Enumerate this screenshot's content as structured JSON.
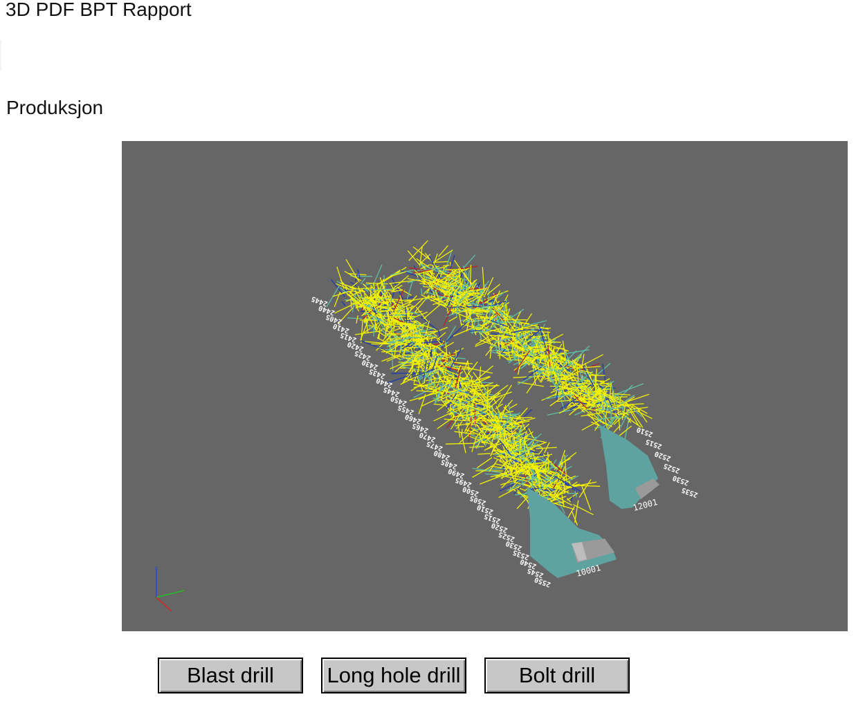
{
  "document": {
    "title": "3D PDF BPT Rapport",
    "section_heading": "Produksjon"
  },
  "viewer": {
    "background_color": "#666666",
    "drill_hole_color": "#f2f200",
    "tunnel_color": "#5fa3a0",
    "axis_triad": {
      "x_color": "#e02020",
      "y_color": "#20c020",
      "z_color": "#2040ff"
    },
    "left_tunnel_chainage_labels": [
      "2445",
      "2440",
      "2405",
      "2410",
      "2415",
      "2420",
      "2425",
      "2430",
      "2435",
      "2440",
      "2445",
      "2450",
      "2455",
      "2460",
      "2465",
      "2470",
      "2475",
      "2480",
      "2485",
      "2490",
      "2495",
      "2500",
      "2505",
      "2510",
      "2515",
      "2520",
      "2525",
      "2530",
      "2535",
      "2540",
      "2545",
      "2550"
    ],
    "right_tunnel_chainage_labels": [
      "2510",
      "2515",
      "2520",
      "2525",
      "2530",
      "2535"
    ],
    "left_tunnel_id": "10001",
    "right_tunnel_id": "12001"
  },
  "buttons": {
    "blast_drill": "Blast drill",
    "long_hole_drill": "Long hole drill",
    "bolt_drill": "Bolt drill"
  }
}
